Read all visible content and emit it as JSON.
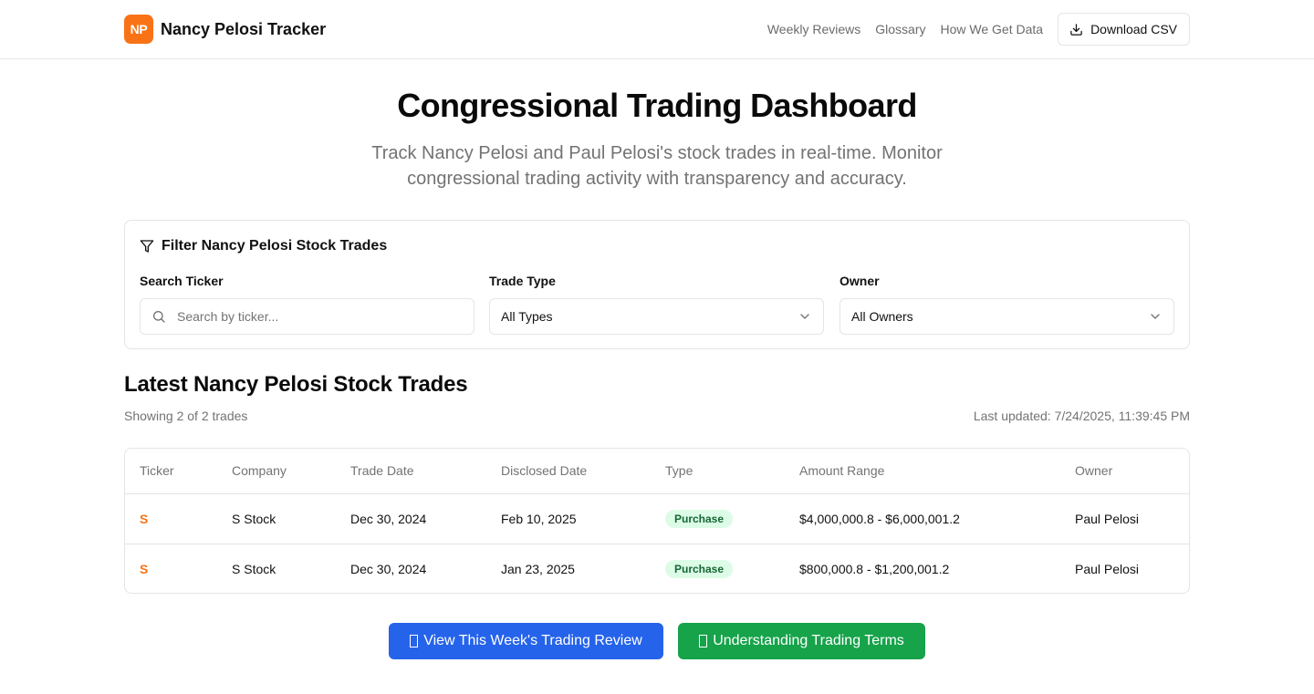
{
  "header": {
    "logo_text": "NP",
    "brand_name": "Nancy Pelosi Tracker",
    "nav": [
      "Weekly Reviews",
      "Glossary",
      "How We Get Data"
    ],
    "download_label": "Download CSV"
  },
  "hero": {
    "title": "Congressional Trading Dashboard",
    "subtitle": "Track Nancy Pelosi and Paul Pelosi's stock trades in real-time. Monitor congressional trading activity with transparency and accuracy."
  },
  "filters": {
    "title": "Filter Nancy Pelosi Stock Trades",
    "search_label": "Search Ticker",
    "search_placeholder": "Search by ticker...",
    "type_label": "Trade Type",
    "type_value": "All Types",
    "owner_label": "Owner",
    "owner_value": "All Owners"
  },
  "trades": {
    "title": "Latest Nancy Pelosi Stock Trades",
    "showing": "Showing 2 of 2 trades",
    "last_updated": "Last updated: 7/24/2025, 11:39:45 PM",
    "columns": [
      "Ticker",
      "Company",
      "Trade Date",
      "Disclosed Date",
      "Type",
      "Amount Range",
      "Owner"
    ],
    "rows": [
      {
        "ticker": "S",
        "company": "S Stock",
        "trade_date": "Dec 30, 2024",
        "disclosed_date": "Feb 10, 2025",
        "type": "Purchase",
        "amount": "$4,000,000.8 - $6,000,001.2",
        "owner": "Paul Pelosi"
      },
      {
        "ticker": "S",
        "company": "S Stock",
        "trade_date": "Dec 30, 2024",
        "disclosed_date": "Jan 23, 2025",
        "type": "Purchase",
        "amount": "$800,000.8 - $1,200,001.2",
        "owner": "Paul Pelosi"
      }
    ]
  },
  "cta": {
    "review_label": "View This Week's Trading Review",
    "terms_label": "Understanding Trading Terms"
  },
  "colors": {
    "accent": "#f97316",
    "blue": "#2563eb",
    "green": "#16a34a",
    "badge_bg": "#dcfce7",
    "badge_text": "#166534"
  }
}
